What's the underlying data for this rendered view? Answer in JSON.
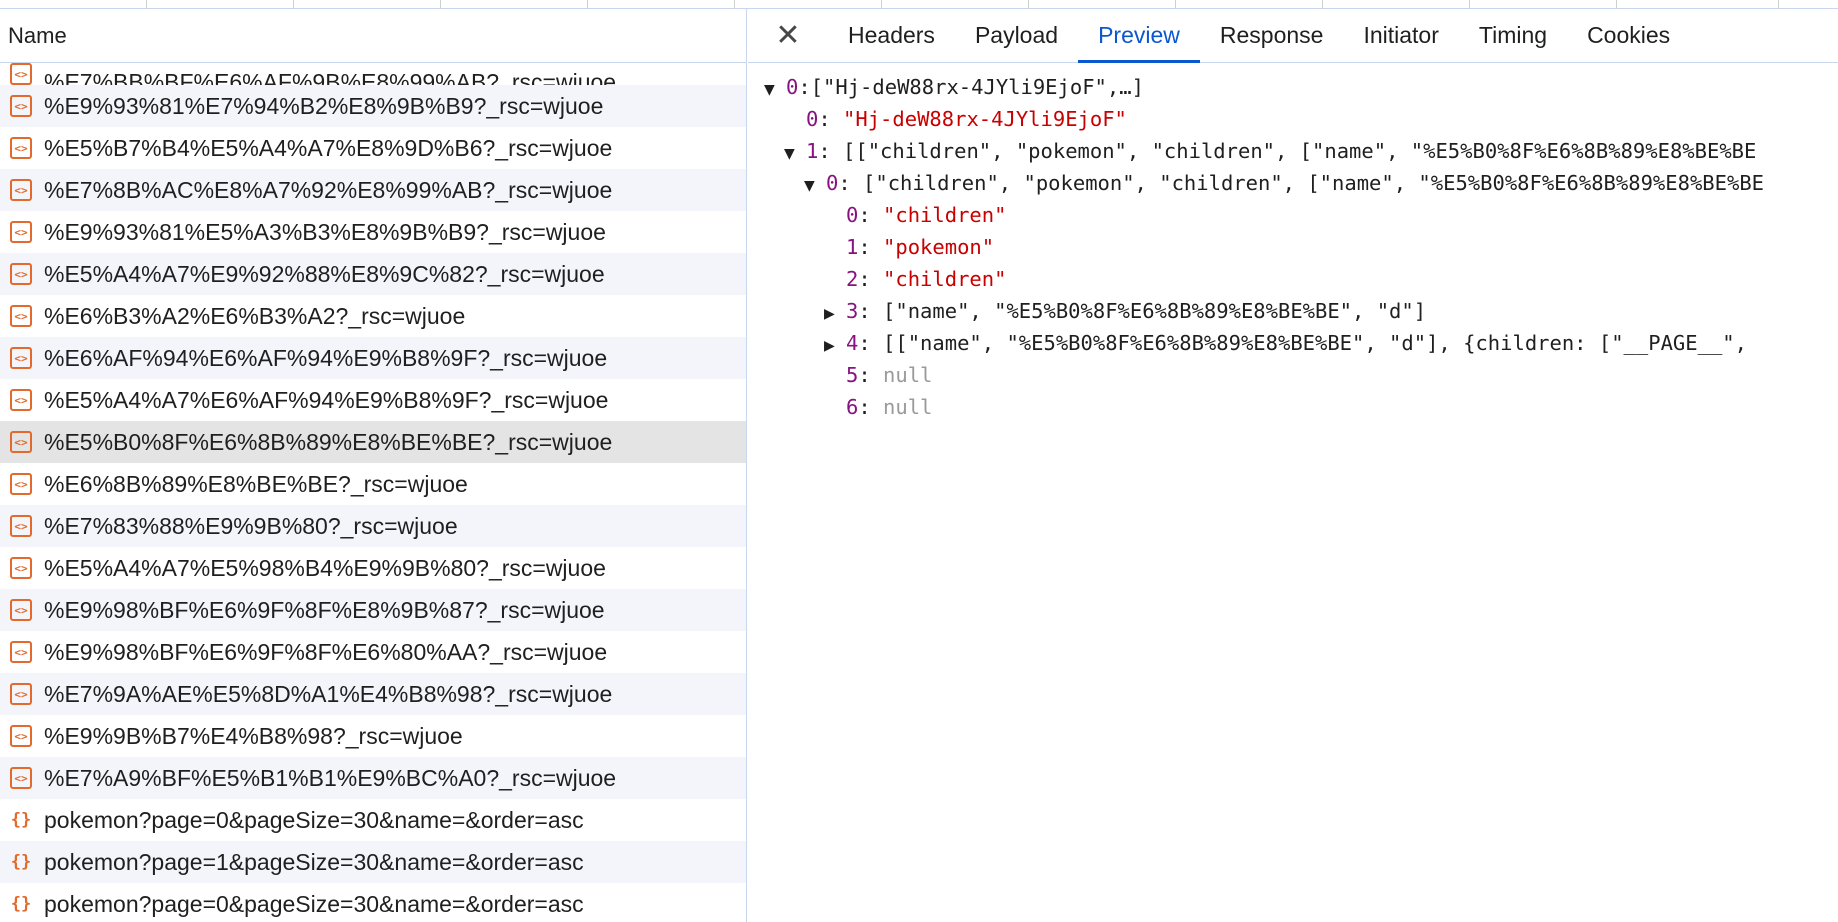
{
  "left_panel": {
    "header": "Name",
    "partial_row": "%E7%BB%BF%E6%AF%9B%E8%99%AB?_rsc=wjuoe",
    "rows": [
      {
        "label": "%E9%93%81%E7%94%B2%E8%9B%B9?_rsc=wjuoe",
        "icon": "document-icon"
      },
      {
        "label": "%E5%B7%B4%E5%A4%A7%E8%9D%B6?_rsc=wjuoe",
        "icon": "document-icon"
      },
      {
        "label": "%E7%8B%AC%E8%A7%92%E8%99%AB?_rsc=wjuoe",
        "icon": "document-icon"
      },
      {
        "label": "%E9%93%81%E5%A3%B3%E8%9B%B9?_rsc=wjuoe",
        "icon": "document-icon"
      },
      {
        "label": "%E5%A4%A7%E9%92%88%E8%9C%82?_rsc=wjuoe",
        "icon": "document-icon"
      },
      {
        "label": "%E6%B3%A2%E6%B3%A2?_rsc=wjuoe",
        "icon": "document-icon"
      },
      {
        "label": "%E6%AF%94%E6%AF%94%E9%B8%9F?_rsc=wjuoe",
        "icon": "document-icon"
      },
      {
        "label": "%E5%A4%A7%E6%AF%94%E9%B8%9F?_rsc=wjuoe",
        "icon": "document-icon"
      },
      {
        "label": "%E5%B0%8F%E6%8B%89%E8%BE%BE?_rsc=wjuoe",
        "icon": "document-icon"
      },
      {
        "label": "%E6%8B%89%E8%BE%BE?_rsc=wjuoe",
        "icon": "document-icon"
      },
      {
        "label": "%E7%83%88%E9%9B%80?_rsc=wjuoe",
        "icon": "document-icon"
      },
      {
        "label": "%E5%A4%A7%E5%98%B4%E9%9B%80?_rsc=wjuoe",
        "icon": "document-icon"
      },
      {
        "label": "%E9%98%BF%E6%9F%8F%E8%9B%87?_rsc=wjuoe",
        "icon": "document-icon"
      },
      {
        "label": "%E9%98%BF%E6%9F%8F%E6%80%AA?_rsc=wjuoe",
        "icon": "document-icon"
      },
      {
        "label": "%E7%9A%AE%E5%8D%A1%E4%B8%98?_rsc=wjuoe",
        "icon": "document-icon"
      },
      {
        "label": "%E9%9B%B7%E4%B8%98?_rsc=wjuoe",
        "icon": "document-icon"
      },
      {
        "label": "%E7%A9%BF%E5%B1%B1%E9%BC%A0?_rsc=wjuoe",
        "icon": "document-icon"
      },
      {
        "label": "pokemon?page=0&pageSize=30&name=&order=asc",
        "icon": "json-icon"
      },
      {
        "label": "pokemon?page=1&pageSize=30&name=&order=asc",
        "icon": "json-icon"
      },
      {
        "label": "pokemon?page=0&pageSize=30&name=&order=asc",
        "icon": "json-icon"
      }
    ],
    "selected_row_index": 8,
    "icon_glyphs": {
      "document-icon": "<>",
      "json-icon": "{}"
    }
  },
  "right_panel": {
    "close_glyph": "✕",
    "tabs": [
      "Headers",
      "Payload",
      "Preview",
      "Response",
      "Initiator",
      "Timing",
      "Cookies"
    ],
    "active_tab": "Preview",
    "tree": [
      {
        "indent": 0,
        "toggle": "expanded",
        "key": "0",
        "sep": ":",
        "value": "[\"Hj-deW88rx-4JYli9EjoF\",…]",
        "kind": "summary"
      },
      {
        "indent": 1,
        "toggle": "none",
        "key": "0",
        "sep": ": ",
        "value": "\"Hj-deW88rx-4JYli9EjoF\"",
        "kind": "string"
      },
      {
        "indent": 1,
        "toggle": "expanded",
        "key": "1",
        "sep": ": ",
        "value": "[[\"children\", \"pokemon\", \"children\", [\"name\", \"%E5%B0%8F%E6%8B%89%E8%BE%BE",
        "kind": "summary"
      },
      {
        "indent": 2,
        "toggle": "expanded",
        "key": "0",
        "sep": ": ",
        "value": "[\"children\", \"pokemon\", \"children\", [\"name\", \"%E5%B0%8F%E6%8B%89%E8%BE%BE",
        "kind": "summary"
      },
      {
        "indent": 3,
        "toggle": "none",
        "key": "0",
        "sep": ": ",
        "value": "\"children\"",
        "kind": "string"
      },
      {
        "indent": 3,
        "toggle": "none",
        "key": "1",
        "sep": ": ",
        "value": "\"pokemon\"",
        "kind": "string"
      },
      {
        "indent": 3,
        "toggle": "none",
        "key": "2",
        "sep": ": ",
        "value": "\"children\"",
        "kind": "string"
      },
      {
        "indent": 3,
        "toggle": "collapsed",
        "key": "3",
        "sep": ": ",
        "value": "[\"name\", \"%E5%B0%8F%E6%8B%89%E8%BE%BE\", \"d\"]",
        "kind": "summary"
      },
      {
        "indent": 3,
        "toggle": "collapsed",
        "key": "4",
        "sep": ": ",
        "value": "[[\"name\", \"%E5%B0%8F%E6%8B%89%E8%BE%BE\", \"d\"], {children: [\"__PAGE__\",",
        "kind": "summary"
      },
      {
        "indent": 3,
        "toggle": "none",
        "key": "5",
        "sep": ": ",
        "value": "null",
        "kind": "null"
      },
      {
        "indent": 3,
        "toggle": "none",
        "key": "6",
        "sep": ": ",
        "value": "null",
        "kind": "null"
      }
    ]
  }
}
